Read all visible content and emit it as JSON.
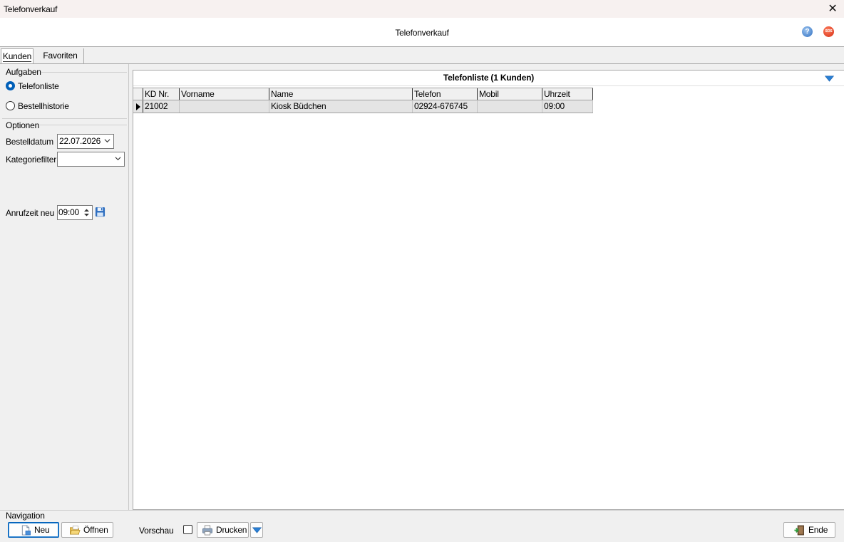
{
  "window": {
    "title": "Telefonverkauf",
    "header_title": "Telefonverkauf"
  },
  "icons": {
    "help": "?",
    "sos": "SOS",
    "close": "✕"
  },
  "tabs": [
    {
      "label": "Kunden",
      "active": true
    },
    {
      "label": "Favoriten",
      "active": false
    }
  ],
  "aufgaben": {
    "title": "Aufgaben",
    "options": [
      {
        "label": "Telefonliste",
        "selected": true
      },
      {
        "label": "Bestellhistorie",
        "selected": false
      }
    ]
  },
  "optionen": {
    "title": "Optionen",
    "bestelldatum_label": "Bestelldatum",
    "bestelldatum_value": "22.07.2026",
    "kategoriefilter_label": "Kategoriefilter",
    "kategoriefilter_value": "",
    "anrufzeit_label": "Anrufzeit neu",
    "anrufzeit_value": "09:00"
  },
  "grid": {
    "title": "Telefonliste (1 Kunden)",
    "columns": [
      "KD Nr.",
      "Vorname",
      "Name",
      "Telefon",
      "Mobil",
      "Uhrzeit"
    ],
    "rows": [
      [
        "21002",
        "",
        "Kiosk Büdchen",
        "02924-676745",
        "",
        "09:00"
      ]
    ]
  },
  "navigation": {
    "title": "Navigation",
    "neu_label": "Neu",
    "oeffnen_label": "Öffnen",
    "vorschau_label": "Vorschau",
    "vorschau_checked": false,
    "drucken_label": "Drucken",
    "ende_label": "Ende"
  },
  "colors": {
    "accent": "#005fb8",
    "dropdown_arrow": "#2a7fd4",
    "selected_row": "#e4e4e4"
  }
}
